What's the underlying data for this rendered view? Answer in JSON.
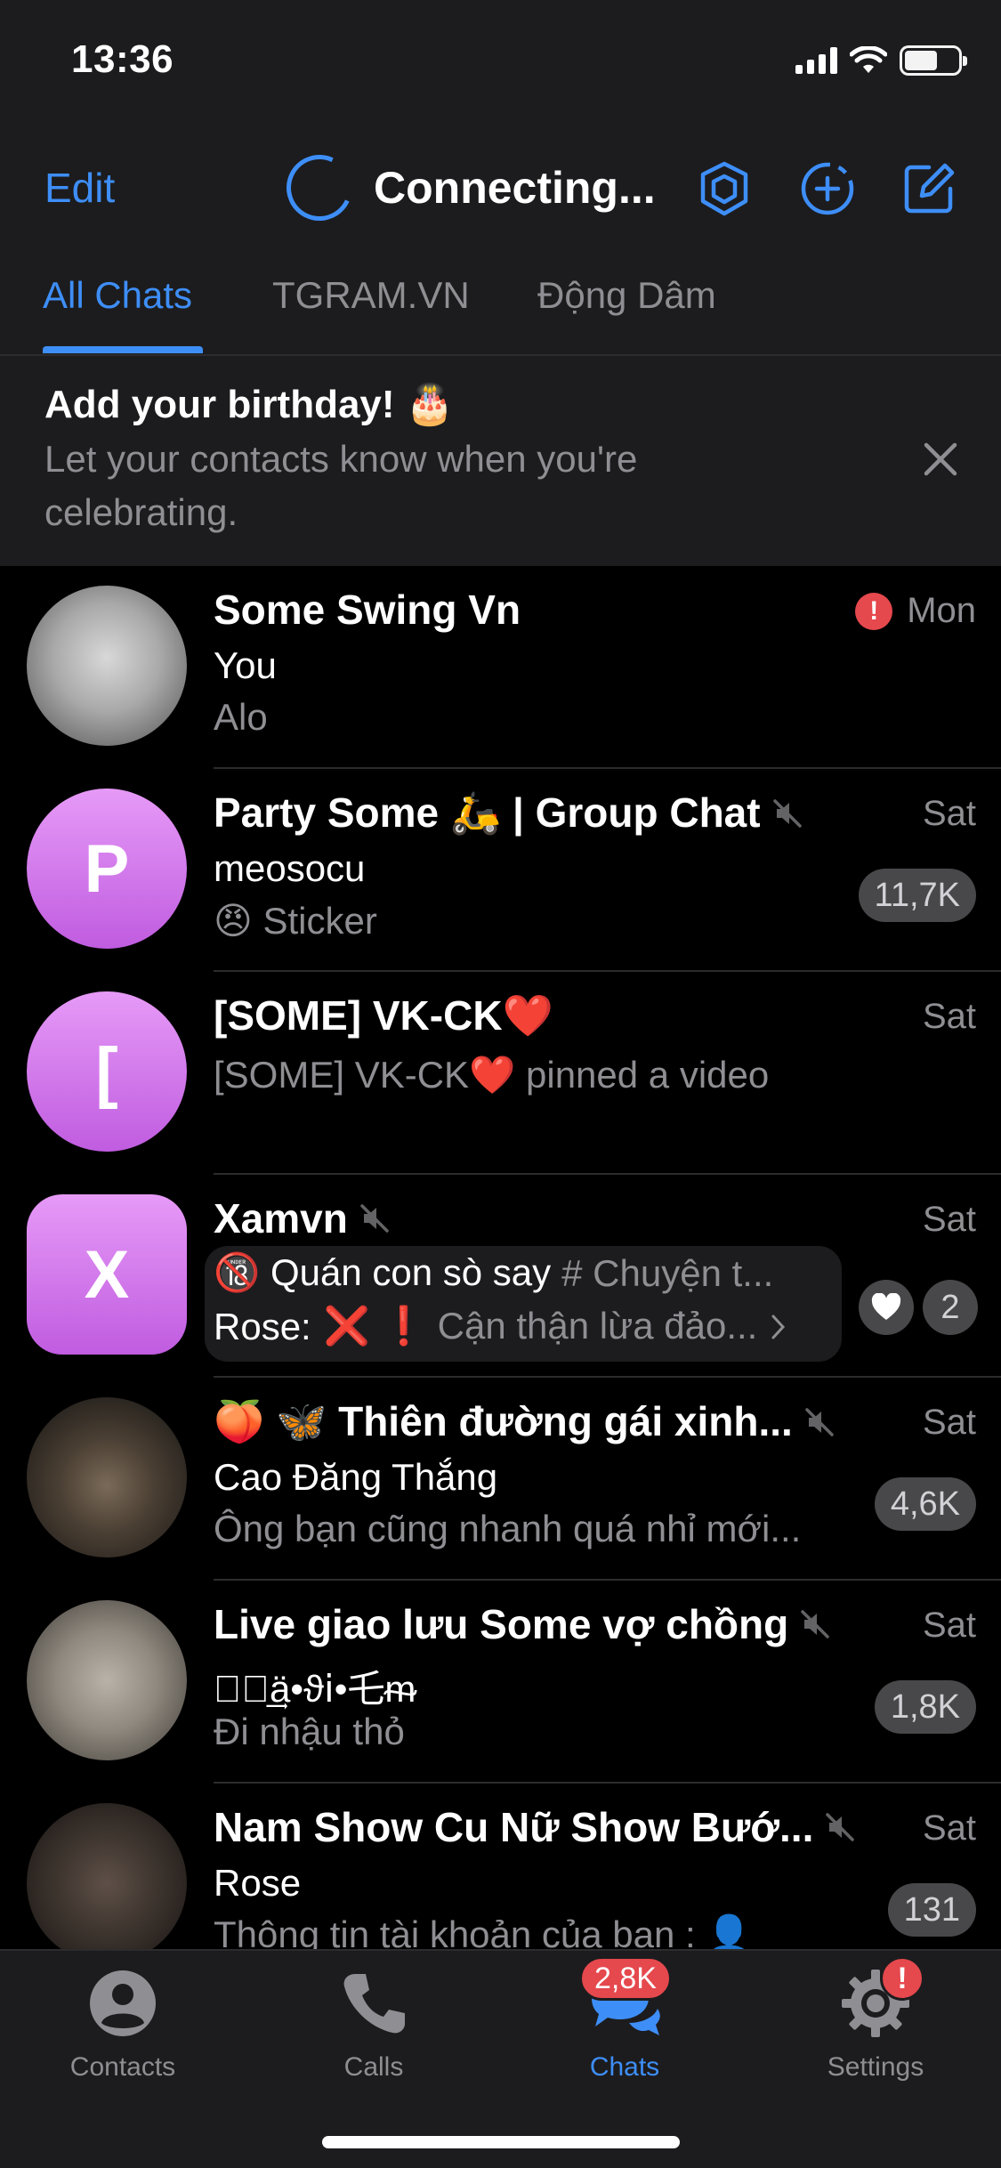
{
  "status_bar": {
    "time": "13:36"
  },
  "nav": {
    "edit_label": "Edit",
    "title": "Connecting..."
  },
  "folder_tabs": [
    {
      "label": "All Chats",
      "active": true
    },
    {
      "label": "TGRAM.VN",
      "active": false
    },
    {
      "label": "Động Dâm",
      "active": false
    }
  ],
  "birthday_banner": {
    "title": "Add your birthday! 🎂",
    "text": "Let your contacts know when you're celebrating."
  },
  "chats": [
    {
      "name": "Some Swing Vn",
      "date": "Mon",
      "error_mark": "!",
      "sender": "You",
      "message": "Alo"
    },
    {
      "avatar_letter": "P",
      "name": "Party Some 🛵 | Group Chat",
      "date": "Sat",
      "sender": "meosocu",
      "message": "😠 Sticker",
      "unread": "11,7K",
      "muted": true
    },
    {
      "avatar_letter": "[",
      "name": "[SOME] VK-CK❤️",
      "date": "Sat",
      "message": "[SOME] VK-CK❤️ pinned a video"
    },
    {
      "avatar_letter": "X",
      "name": "Xamvn",
      "date": "Sat",
      "muted": true,
      "topic_1": "🔞 Quán con sò say",
      "topic_2": "# Chuyện t...",
      "sender": "Rose:",
      "message": "❌ ❗ Cận thận lừa đảo...",
      "unread": "2"
    },
    {
      "name": "🍑 🦋 Thiên đường gái xinh...",
      "date": "Sat",
      "sender": "Cao Đăng Thắng",
      "message": "Ông bạn cũng nhanh quá nhỉ mới...",
      "unread": "4,6K",
      "muted": true
    },
    {
      "name": "Live giao lưu Some vợ chồng",
      "date": "Sat",
      "sender": "❀ⷪ͢ä•ϑⅰ•乇ᵯ",
      "message": "Đi nhậu thỏ",
      "unread": "1,8K",
      "muted": true
    },
    {
      "name": "Nam Show Cu Nữ Show Bướ...",
      "date": "Sat",
      "sender": "Rose",
      "message": "Thông tin tài khoản của bạn : 👤",
      "unread": "131",
      "muted": true
    }
  ],
  "tabbar": {
    "contacts": "Contacts",
    "calls": "Calls",
    "chats": "Chats",
    "chats_badge": "2,8K",
    "settings": "Settings",
    "settings_badge": "!"
  },
  "colors": {
    "accent": "#3e8ef7",
    "avatar_purple": "#d47ef0",
    "badge_red": "#e5484d"
  }
}
